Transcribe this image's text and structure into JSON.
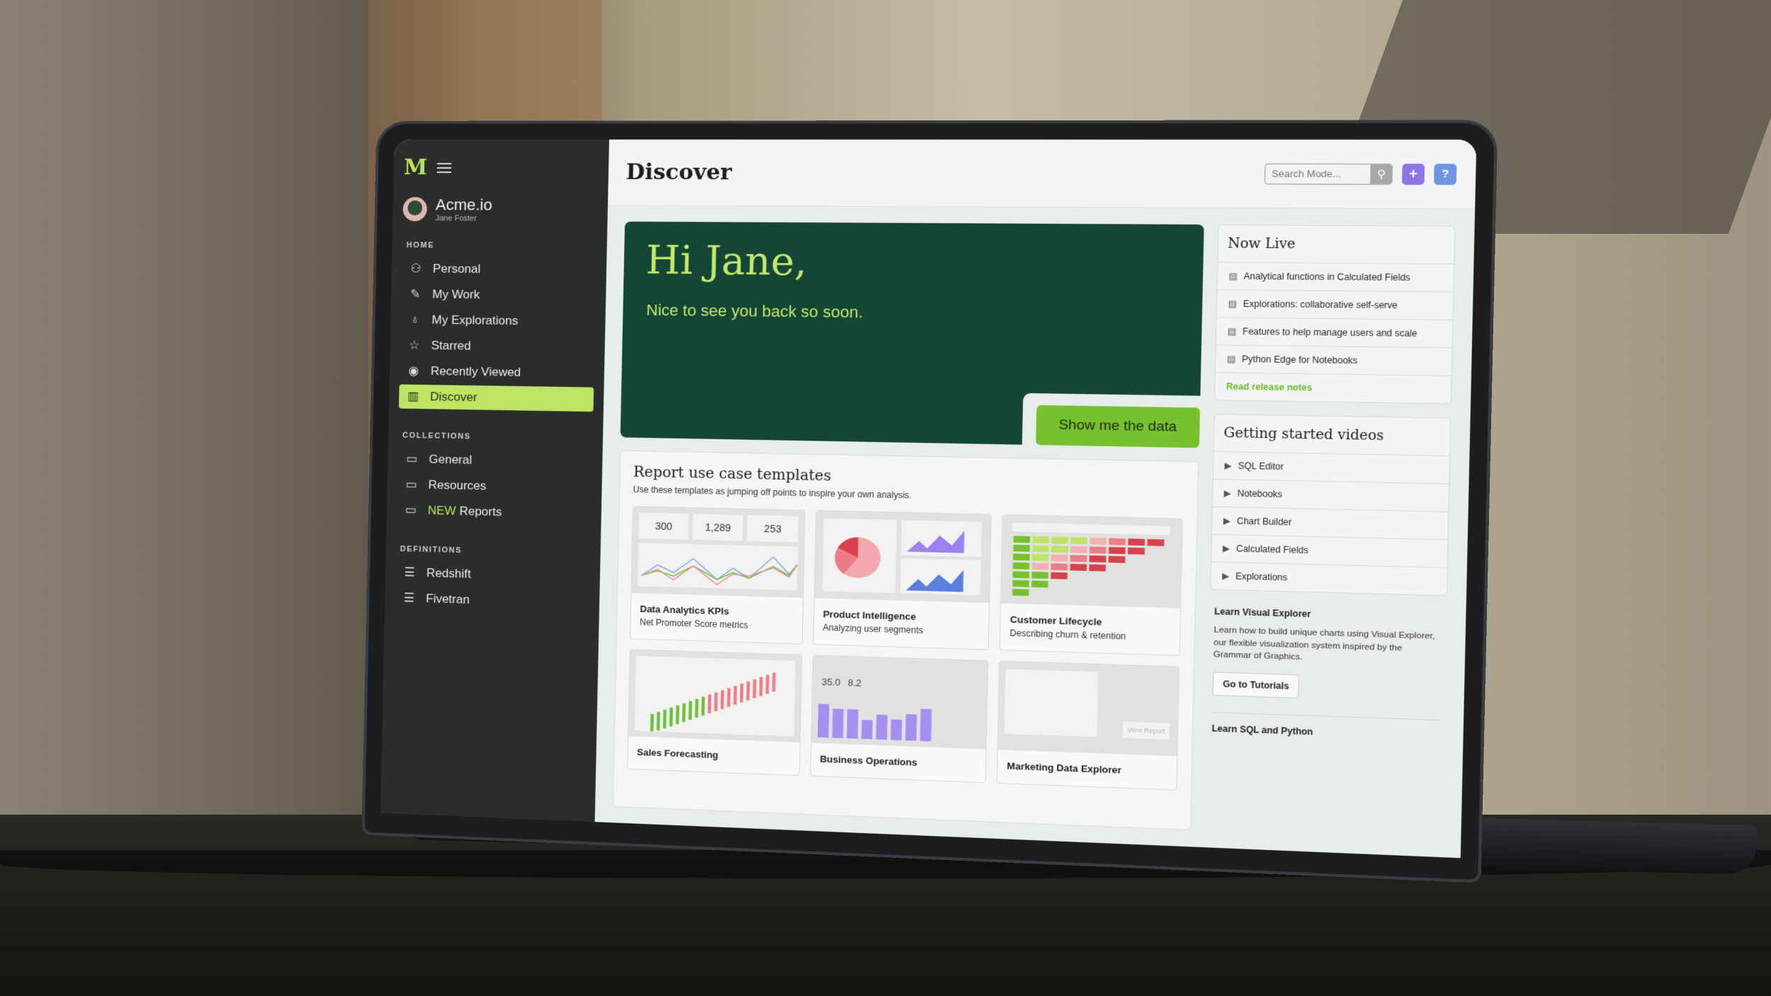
{
  "app": {
    "logo": "M",
    "org_name": "Acme.io",
    "user_name": "Jane Foster"
  },
  "sidebar": {
    "sections": [
      {
        "label": "HOME",
        "items": [
          {
            "label": "Personal",
            "icon": "person-icon"
          },
          {
            "label": "My Work",
            "icon": "pencil-icon"
          },
          {
            "label": "My Explorations",
            "icon": "lightbulb-icon"
          },
          {
            "label": "Starred",
            "icon": "star-icon"
          },
          {
            "label": "Recently Viewed",
            "icon": "eye-icon"
          },
          {
            "label": "Discover",
            "icon": "map-icon",
            "active": true
          }
        ]
      },
      {
        "label": "COLLECTIONS",
        "items": [
          {
            "label": "General",
            "icon": "collection-icon"
          },
          {
            "label": "Resources",
            "icon": "collection-icon"
          },
          {
            "label": "Reports",
            "tag": "NEW",
            "icon": "collection-icon"
          }
        ]
      },
      {
        "label": "DEFINITIONS",
        "items": [
          {
            "label": "Redshift",
            "icon": "database-icon"
          },
          {
            "label": "Fivetran",
            "icon": "database-icon"
          }
        ]
      }
    ]
  },
  "header": {
    "title": "Discover",
    "search_placeholder": "Search Mode...",
    "add_label": "+",
    "help_label": "?"
  },
  "hero": {
    "greeting": "Hi Jane,",
    "subtitle": "Nice to see you back so soon.",
    "cta": "Show me the data"
  },
  "templates": {
    "title": "Report use case templates",
    "subtitle": "Use these templates as jumping off points to inspire your own analysis.",
    "cards": [
      {
        "name": "Data Analytics KPIs",
        "desc": "Net Promoter Score metrics",
        "kpis": [
          "300",
          "1,289",
          "253"
        ]
      },
      {
        "name": "Product Intelligence",
        "desc": "Analyzing user segments"
      },
      {
        "name": "Customer Lifecycle",
        "desc": "Describing churn & retention"
      },
      {
        "name": "Sales Forecasting",
        "desc": ""
      },
      {
        "name": "Business Operations",
        "desc": "",
        "kpis": [
          "35.0",
          "8.2"
        ]
      },
      {
        "name": "Marketing Data Explorer",
        "desc": "",
        "button": "View Report"
      }
    ]
  },
  "now_live": {
    "title": "Now Live",
    "items": [
      "Analytical functions in Calculated Fields",
      "Explorations: collaborative self-serve",
      "Features to help manage users and scale",
      "Python Edge for Notebooks"
    ],
    "link": "Read release notes"
  },
  "videos": {
    "title": "Getting started videos",
    "items": [
      "SQL Editor",
      "Notebooks",
      "Chart Builder",
      "Calculated Fields",
      "Explorations"
    ]
  },
  "learn_visual": {
    "title": "Learn Visual Explorer",
    "text": "Learn how to build unique charts using Visual Explorer, our flexible visualization system inspired by the Grammar of Graphics.",
    "button": "Go to Tutorials"
  },
  "learn_sql": {
    "title": "Learn SQL and Python"
  },
  "colors": {
    "accent_green": "#bde465",
    "hero_bg": "#144535",
    "cta_green": "#76c12d",
    "purple": "#8f74e8",
    "blue": "#6f95e2"
  }
}
